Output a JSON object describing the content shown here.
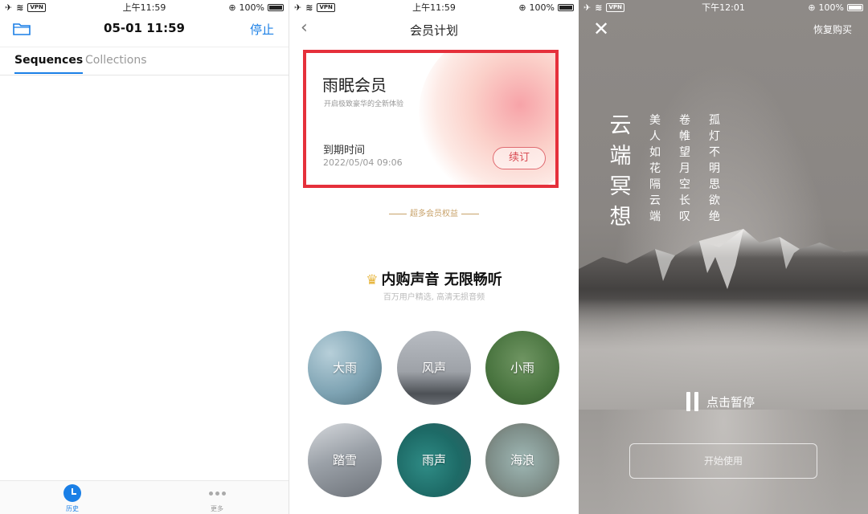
{
  "statusbar": {
    "vpn": "VPN",
    "time1": "上午11:59",
    "time2": "上午11:59",
    "time3": "下午12:01",
    "battery": "100%"
  },
  "panel1": {
    "nav_title": "05-01 11:59",
    "stop_label": "停止",
    "tabs": [
      {
        "label": "Sequences",
        "active": true
      },
      {
        "label": "Collections",
        "active": false
      }
    ],
    "tabbar": [
      {
        "label": "历史",
        "icon": "clock-icon",
        "active": true
      },
      {
        "label": "更多",
        "icon": "more-dots-icon",
        "active": false
      }
    ]
  },
  "panel2": {
    "nav_title": "会员计划",
    "card": {
      "name": "雨眠会员",
      "subtitle": "开启极致豪华的全新体验",
      "expiry_label": "到期时间",
      "expiry_date": "2022/05/04 09:06",
      "renew_label": "续订"
    },
    "benefits_heading": "超多会员权益",
    "promo_title": "内购声音  无限畅听",
    "promo_subtitle": "百万用户精选, 高清无损音频",
    "sounds": [
      "大雨",
      "风声",
      "小雨",
      "踏雪",
      "雨声",
      "海浪"
    ]
  },
  "panel3": {
    "restore_label": "恢复购买",
    "title_vertical": [
      "云",
      "端",
      "冥",
      "想"
    ],
    "poem_columns": [
      [
        "美",
        "人",
        "如",
        "花",
        "隔",
        "云",
        "端"
      ],
      [
        "卷",
        "帷",
        "望",
        "月",
        "空",
        "长",
        "叹"
      ],
      [
        "孤",
        "灯",
        "不",
        "明",
        "思",
        "欲",
        "绝"
      ]
    ],
    "pause_label": "点击暂停",
    "start_label": "开始使用"
  },
  "colors": {
    "accent_blue": "#1a7fe6",
    "highlight_red": "#e5303b",
    "gold": "#c8a26a"
  }
}
